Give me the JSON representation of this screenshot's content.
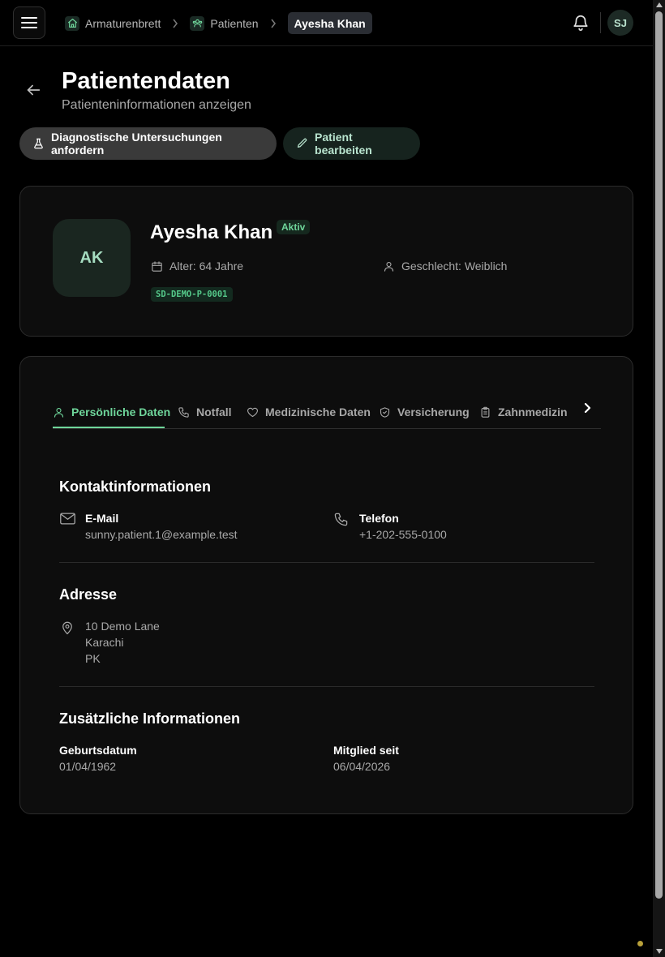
{
  "breadcrumb": {
    "home": "Armaturenbrett",
    "patients": "Patienten",
    "current": "Ayesha Khan"
  },
  "user": {
    "initials": "SJ"
  },
  "page": {
    "title": "Patientendaten",
    "subtitle": "Patienteninformationen anzeigen"
  },
  "actions": {
    "diagnostics": "Diagnostische Untersuchungen anfordern",
    "edit": "Patient bearbeiten"
  },
  "patient": {
    "initials": "AK",
    "name": "Ayesha Khan",
    "status": "Aktiv",
    "age": "Alter: 64 Jahre",
    "gender": "Geschlecht: Weiblich",
    "id": "SD-DEMO-P-0001"
  },
  "tabs": [
    {
      "label": "Persönliche Daten",
      "icon": "user-icon",
      "active": true
    },
    {
      "label": "Notfall",
      "icon": "phone-icon",
      "active": false
    },
    {
      "label": "Medizinische Daten",
      "icon": "heart-icon",
      "active": false
    },
    {
      "label": "Versicherung",
      "icon": "shield-icon",
      "active": false
    },
    {
      "label": "Zahnmedizin",
      "icon": "clipboard-icon",
      "active": false
    }
  ],
  "contact": {
    "title": "Kontaktinformationen",
    "email_label": "E-Mail",
    "email": "sunny.patient.1@example.test",
    "phone_label": "Telefon",
    "phone": "+1-202-555-0100"
  },
  "address": {
    "title": "Adresse",
    "line1": "10 Demo Lane",
    "line2": "Karachi",
    "line3": "PK"
  },
  "additional": {
    "title": "Zusätzliche Informationen",
    "dob_label": "Geburtsdatum",
    "dob": "01/04/1962",
    "member_label": "Mitglied seit",
    "member_since": "06/04/2026"
  },
  "colors": {
    "accent": "#6fd69b",
    "background": "#000000",
    "card": "#0d0d0d"
  }
}
